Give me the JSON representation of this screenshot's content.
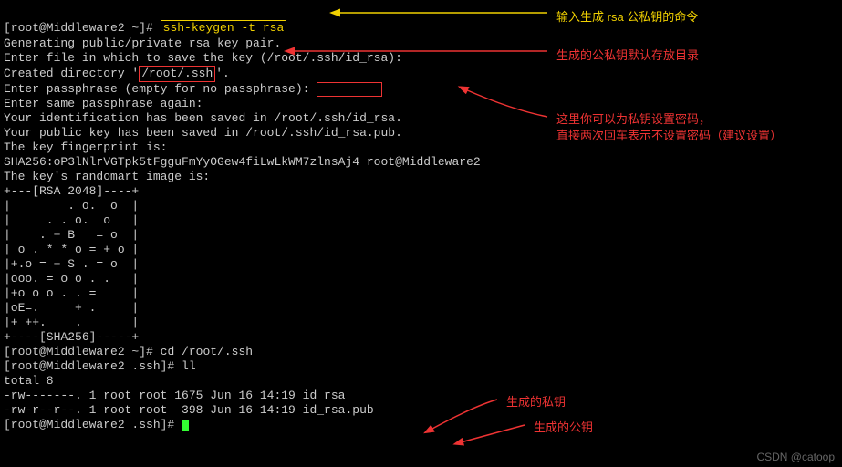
{
  "prompt1": "[root@Middleware2 ~]# ",
  "cmd1": "ssh-keygen -t rsa",
  "lines": {
    "l1": "Generating public/private rsa key pair.",
    "l2a": "Enter file in which to save the key (/root/.ssh/id_rsa):",
    "l3a": "Created directory '",
    "l3b": "/root/.ssh",
    "l3c": "'.",
    "l4": "Enter passphrase (empty for no passphrase):",
    "l5": "Enter same passphrase again:",
    "l6": "Your identification has been saved in /root/.ssh/id_rsa.",
    "l7": "Your public key has been saved in /root/.ssh/id_rsa.pub.",
    "l8": "The key fingerprint is:",
    "l9": "SHA256:oP3lNlrVGTpk5tFgguFmYyOGew4fiLwLkWM7zlnsAj4 root@Middleware2",
    "l10": "The key's randomart image is:",
    "a0": "+---[RSA 2048]----+",
    "a1": "|        . o.  o  |",
    "a2": "|     . . o.  o   |",
    "a3": "|    . + B   = o  |",
    "a4": "| o . * * o = + o |",
    "a5": "|+.o = + S . = o  |",
    "a6": "|ooo. = o o . .   |",
    "a7": "|+o o o . . =     |",
    "a8": "|oE=.     + .     |",
    "a9": "|+ ++.    .       |",
    "a10": "+----[SHA256]-----+"
  },
  "prompt2": "[root@Middleware2 ~]# ",
  "cmd2": "cd /root/.ssh",
  "prompt3": "[root@Middleware2 .ssh]# ",
  "cmd3": "ll",
  "total": "total 8",
  "file1": "-rw-------. 1 root root 1675 Jun 16 14:19 id_rsa",
  "file2": "-rw-r--r--. 1 root root  398 Jun 16 14:19 id_rsa.pub",
  "prompt4": "[root@Middleware2 .ssh]# ",
  "annotations": {
    "a1": "输入生成 rsa 公私钥的命令",
    "a2": "生成的公私钥默认存放目录",
    "a3": "这里你可以为私钥设置密码，",
    "a3b": "直接两次回车表示不设置密码（建议设置）",
    "a4": "生成的私钥",
    "a5": "生成的公钥"
  },
  "watermark": "CSDN @catoop"
}
